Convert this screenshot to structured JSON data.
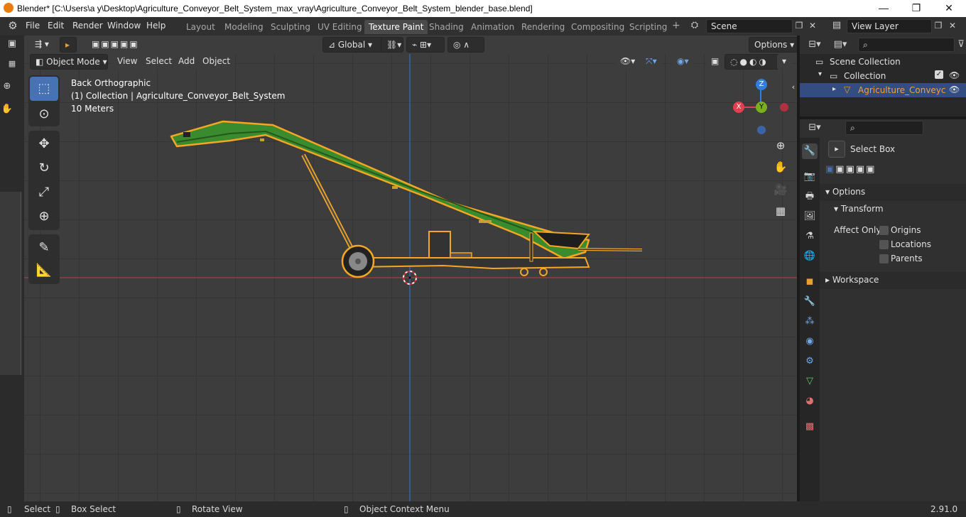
{
  "window": {
    "title": "Blender* [C:\\Users\\a y\\Desktop\\Agriculture_Conveyor_Belt_System_max_vray\\Agriculture_Conveyor_Belt_System_blender_base.blend]",
    "minimize": "—",
    "maximize": "❐",
    "close": "✕"
  },
  "menu": {
    "items": [
      "File",
      "Edit",
      "Render",
      "Window",
      "Help"
    ]
  },
  "workspaces": {
    "tabs": [
      "Layout",
      "Modeling",
      "Sculpting",
      "UV Editing",
      "Texture Paint",
      "Shading",
      "Animation",
      "Rendering",
      "Compositing",
      "Scripting"
    ],
    "active": "Texture Paint",
    "add": "+"
  },
  "scene": {
    "label": "Scene"
  },
  "view_layer": {
    "label": "View Layer"
  },
  "tool_header": {
    "orientation": "Global",
    "options": "Options"
  },
  "viewport_header": {
    "mode": "Object Mode",
    "menus": [
      "View",
      "Select",
      "Add",
      "Object"
    ]
  },
  "viewport_overlay": {
    "view_name": "Back Orthographic",
    "collection_info": "(1) Collection | Agriculture_Conveyor_Belt_System",
    "scale": "10 Meters"
  },
  "gizmo": {
    "z": "Z",
    "x": "X",
    "y": "Y"
  },
  "outliner": {
    "scene_collection": "Scene Collection",
    "collection": "Collection",
    "object": "Agriculture_Conveyc"
  },
  "properties": {
    "tool_name": "Select Box",
    "options_panel": "Options",
    "transform_panel": "Transform",
    "affect_only": "Affect Only",
    "checkboxes": [
      "Origins",
      "Locations",
      "Parents"
    ],
    "workspace_panel": "Workspace"
  },
  "statusbar": {
    "select": "Select",
    "box_select": "Box Select",
    "rotate_view": "Rotate View",
    "context_menu": "Object Context Menu",
    "version": "2.91.0"
  },
  "colors": {
    "accent": "#4772b3",
    "selection_outline": "#f5a623",
    "model_green": "#3a8a2e",
    "axis_red": "#c83c3c",
    "axis_blue": "#3c78c8"
  }
}
